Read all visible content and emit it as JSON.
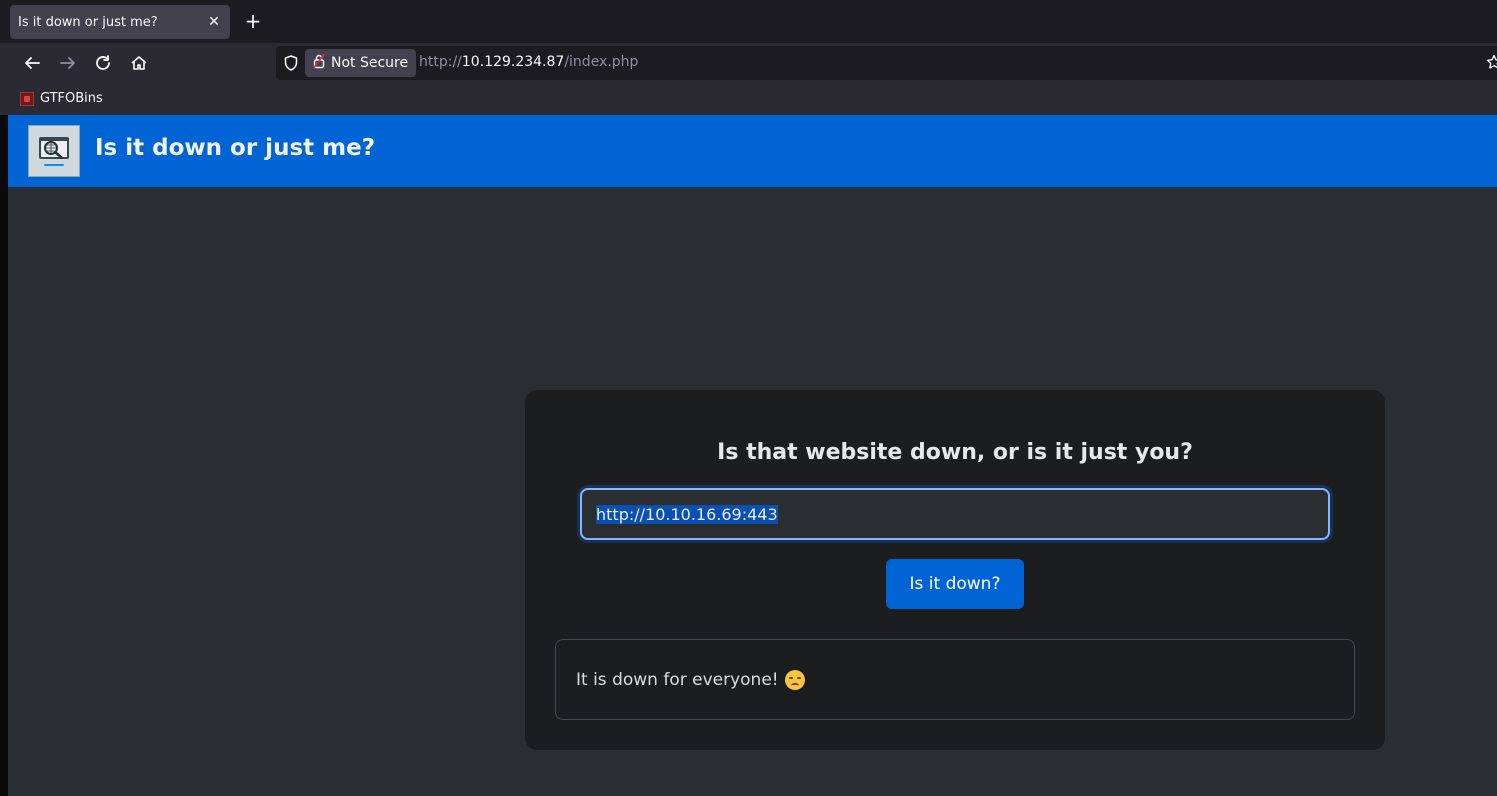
{
  "browser": {
    "tab": {
      "title": "Is it down or just me?",
      "close_glyph": "✕"
    },
    "new_tab_glyph": "+",
    "nav": {
      "back_icon": "back-arrow-icon",
      "forward_icon": "forward-arrow-icon",
      "reload_icon": "reload-icon",
      "home_icon": "home-icon"
    },
    "urlbar": {
      "security_label": "Not Secure",
      "url_prefix": "http://",
      "url_host": "10.129.234.87",
      "url_path": "/index.php"
    },
    "bookmarks": [
      {
        "label": "GTFOBins"
      }
    ]
  },
  "site": {
    "title": "Is it down or just me?",
    "card": {
      "heading": "Is that website down, or is it just you?",
      "input_value": "http://10.10.16.69:443",
      "button_label": "Is it down?",
      "result_text": "It is down for everyone!"
    }
  },
  "colors": {
    "brand": "#0064d4",
    "background": "#2b2e31",
    "card": "#1c1d1f"
  }
}
